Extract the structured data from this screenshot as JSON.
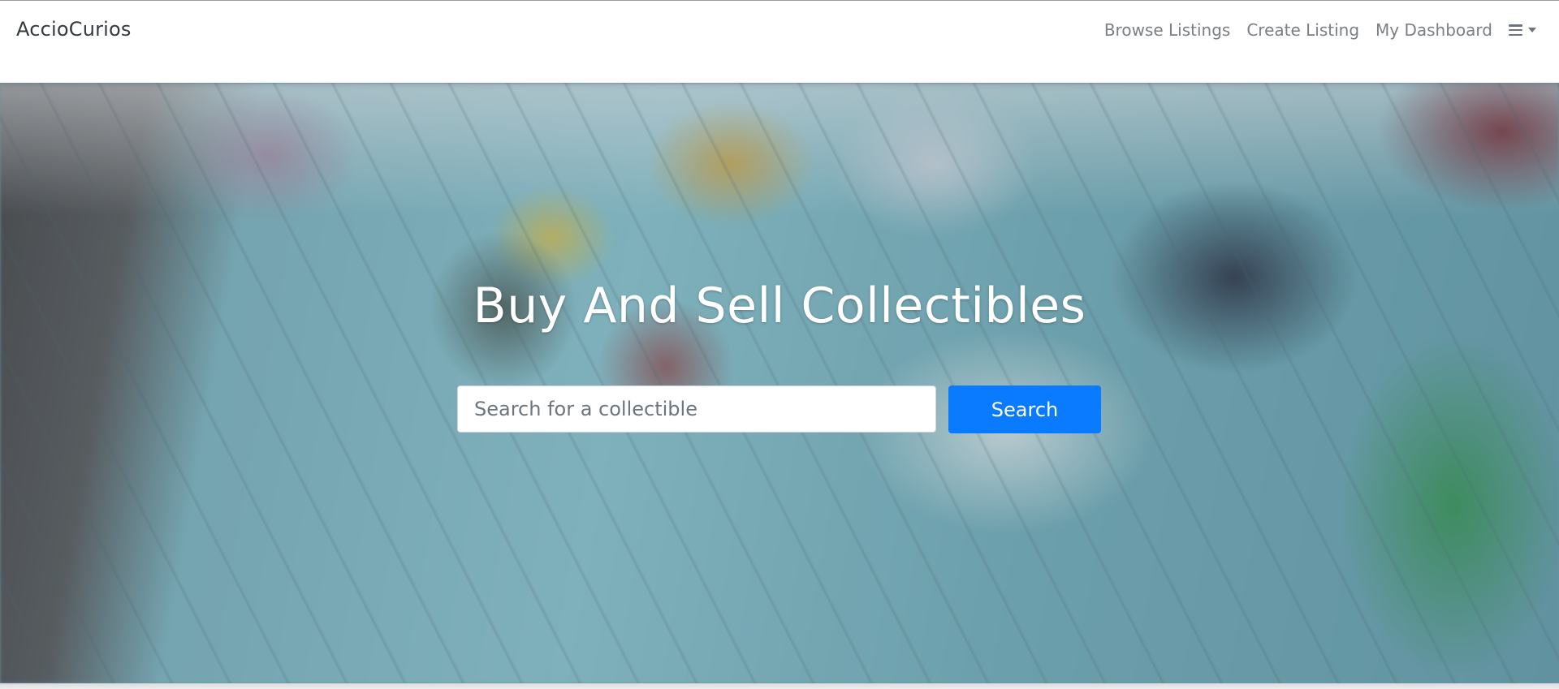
{
  "navbar": {
    "brand": "AccioCurios",
    "links": [
      {
        "label": "Browse Listings"
      },
      {
        "label": "Create Listing"
      },
      {
        "label": "My Dashboard"
      }
    ],
    "menu_icon": "hamburger-menu-icon"
  },
  "hero": {
    "title": "Buy And Sell Collectibles",
    "background_description_icon": "toy-cars-on-blue-table-image",
    "search": {
      "placeholder": "Search for a collectible",
      "value": "",
      "button_label": "Search"
    }
  },
  "colors": {
    "primary": "#0a7bff",
    "navbar_bg": "#ffffff",
    "nav_link": "#7b7f83",
    "brand": "#343a40"
  }
}
